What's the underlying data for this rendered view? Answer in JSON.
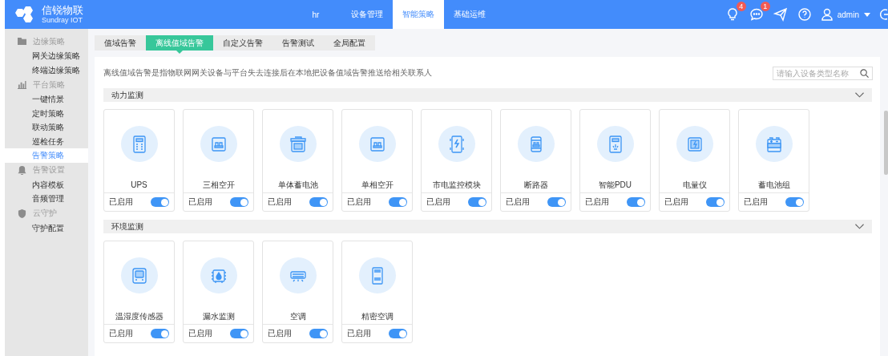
{
  "header": {
    "logo_title": "信锐物联",
    "logo_subtitle": "Sundray IOT",
    "nav": [
      {
        "label": "hr",
        "selected": false
      },
      {
        "label": "设备管理",
        "selected": false
      },
      {
        "label": "智能策略",
        "selected": true
      },
      {
        "label": "基础运维",
        "selected": false
      }
    ],
    "tools": [
      {
        "kind": "bulb",
        "badge": "4"
      },
      {
        "kind": "chat",
        "badge": "1"
      },
      {
        "kind": "send"
      },
      {
        "kind": "help"
      }
    ],
    "user": "admin"
  },
  "sidebar": {
    "groups": [
      {
        "label": "边缘策略",
        "kind": "folder",
        "children": [
          {
            "label": "网关边缘策略",
            "selected": false
          },
          {
            "label": "终端边缘策略",
            "selected": false
          }
        ]
      },
      {
        "label": "平台策略",
        "kind": "chart",
        "children": [
          {
            "label": "一键情景",
            "selected": false
          },
          {
            "label": "定时策略",
            "selected": false
          },
          {
            "label": "联动策略",
            "selected": false
          },
          {
            "label": "巡检任务",
            "selected": false
          },
          {
            "label": "告警策略",
            "selected": true
          }
        ]
      },
      {
        "label": "告警设置",
        "kind": "bell",
        "children": [
          {
            "label": "内容模板",
            "selected": false
          },
          {
            "label": "音频管理",
            "selected": false
          }
        ]
      },
      {
        "label": "云守护",
        "kind": "shield",
        "children": [
          {
            "label": "守护配置",
            "selected": false
          }
        ]
      }
    ]
  },
  "tabs": [
    {
      "label": "值域告警",
      "selected": false
    },
    {
      "label": "离线值域告警",
      "selected": true
    },
    {
      "label": "自定义告警",
      "selected": false
    },
    {
      "label": "告警测试",
      "selected": false
    },
    {
      "label": "全局配置",
      "selected": false
    }
  ],
  "description": "离线值域告警是指物联网网关设备与平台失去连接后在本地把设备值域告警推送给相关联系人",
  "search": {
    "placeholder": "请输入设备类型名称"
  },
  "sections": [
    {
      "title": "动力监测",
      "cards": [
        {
          "name": "UPS",
          "kind": "ups",
          "status": "已启用",
          "enabled": true
        },
        {
          "name": "三相空开",
          "kind": "switch",
          "status": "已启用",
          "enabled": true
        },
        {
          "name": "单体蓄电池",
          "kind": "battery",
          "status": "已启用",
          "enabled": true
        },
        {
          "name": "单相空开",
          "kind": "switch",
          "status": "已启用",
          "enabled": true
        },
        {
          "name": "市电监控模块",
          "kind": "mains",
          "status": "已启用",
          "enabled": true
        },
        {
          "name": "断路器",
          "kind": "breaker",
          "status": "已启用",
          "enabled": true
        },
        {
          "name": "智能PDU",
          "kind": "pdu",
          "status": "已启用",
          "enabled": true
        },
        {
          "name": "电量仪",
          "kind": "meter",
          "status": "已启用",
          "enabled": true
        },
        {
          "name": "蓄电池组",
          "kind": "pack",
          "status": "已启用",
          "enabled": true
        }
      ]
    },
    {
      "title": "环境监测",
      "cards": [
        {
          "name": "温湿度传感器",
          "kind": "sensor",
          "status": "已启用",
          "enabled": true
        },
        {
          "name": "漏水监测",
          "kind": "leak",
          "status": "已启用",
          "enabled": true
        },
        {
          "name": "空调",
          "kind": "ac",
          "status": "已启用",
          "enabled": true
        },
        {
          "name": "精密空调",
          "kind": "cabinet",
          "status": "已启用",
          "enabled": true
        }
      ]
    }
  ]
}
